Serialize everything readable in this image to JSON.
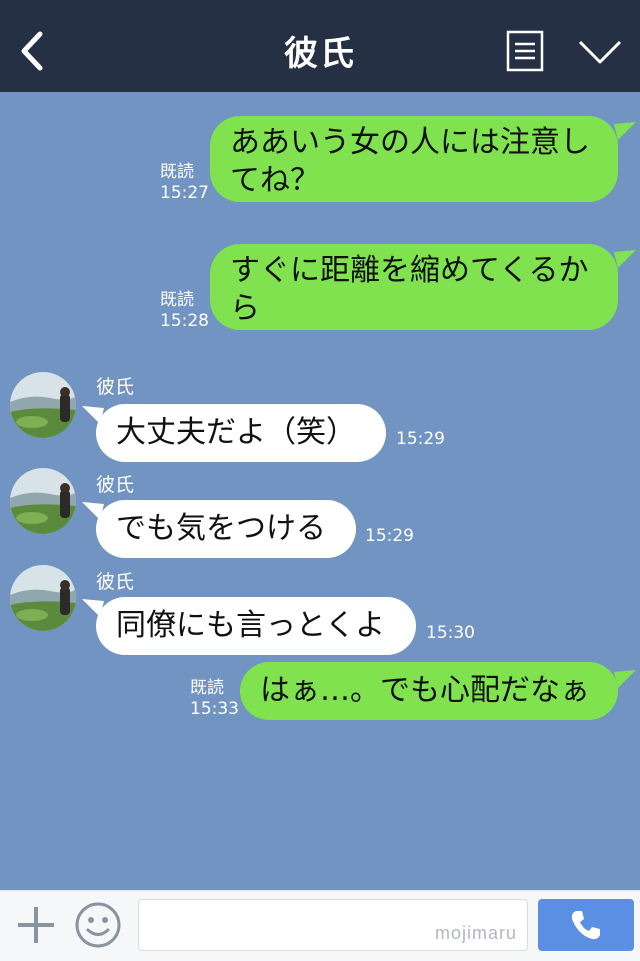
{
  "header": {
    "title": "彼氏",
    "bg_color": "#253045",
    "icons": {
      "back": "chevron-left-icon",
      "menu": "list-icon",
      "toggle": "chevron-down-icon"
    }
  },
  "chat": {
    "bg_color": "#7294c2",
    "out_bubble_color": "#80e24f",
    "in_bubble_color": "#ffffff",
    "messages": [
      {
        "direction": "out",
        "lines": [
          "ああいう女の人には注意し",
          "てね？"
        ],
        "read": "既読",
        "time": "15:27"
      },
      {
        "direction": "out",
        "lines": [
          "すぐに距離を縮めてくるか",
          "ら"
        ],
        "read": "既読",
        "time": "15:28"
      },
      {
        "direction": "in",
        "sender": "彼氏",
        "text": "大丈夫だよ（笑）",
        "time": "15:29"
      },
      {
        "direction": "in",
        "sender": "彼氏",
        "text": "でも気をつける",
        "time": "15:29"
      },
      {
        "direction": "in",
        "sender": "彼氏",
        "text": "同僚にも言っとくよ",
        "time": "15:30"
      },
      {
        "direction": "out",
        "lines": [
          "はぁ…。でも心配だなぁ"
        ],
        "read": "既読",
        "time": "15:33"
      }
    ]
  },
  "composer": {
    "watermark": "mojimaru",
    "icons": {
      "add": "plus-icon",
      "emoji": "smiley-icon",
      "call": "phone-icon"
    },
    "call_color": "#5b8fe3"
  }
}
